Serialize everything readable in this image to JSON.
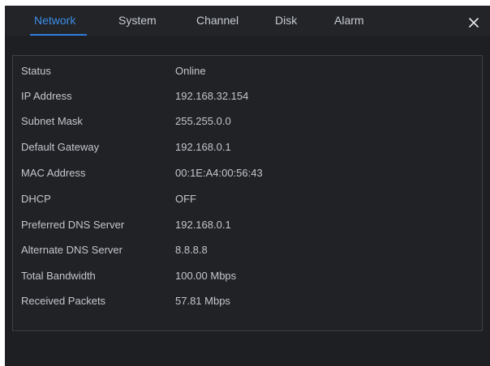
{
  "tabs": [
    {
      "label": "Network",
      "active": true
    },
    {
      "label": "System",
      "active": false
    },
    {
      "label": "Channel",
      "active": false
    },
    {
      "label": "Disk",
      "active": false
    },
    {
      "label": "Alarm",
      "active": false
    }
  ],
  "close_icon": "close-x-icon",
  "rows": [
    {
      "label": "Status",
      "value": "Online"
    },
    {
      "label": "IP Address",
      "value": "192.168.32.154"
    },
    {
      "label": "Subnet Mask",
      "value": "255.255.0.0"
    },
    {
      "label": "Default Gateway",
      "value": "192.168.0.1"
    },
    {
      "label": "MAC Address",
      "value": "00:1E:A4:00:56:43"
    },
    {
      "label": "DHCP",
      "value": "OFF"
    },
    {
      "label": "Preferred DNS Server",
      "value": "192.168.0.1"
    },
    {
      "label": "Alternate DNS Server",
      "value": "8.8.8.8"
    },
    {
      "label": "Total Bandwidth",
      "value": "100.00 Mbps"
    },
    {
      "label": "Received Packets",
      "value": "57.81 Mbps"
    }
  ],
  "colors": {
    "background": "#1d1f23",
    "accent": "#3d8de8",
    "text": "#c3c6cc",
    "border": "#3d4047"
  }
}
